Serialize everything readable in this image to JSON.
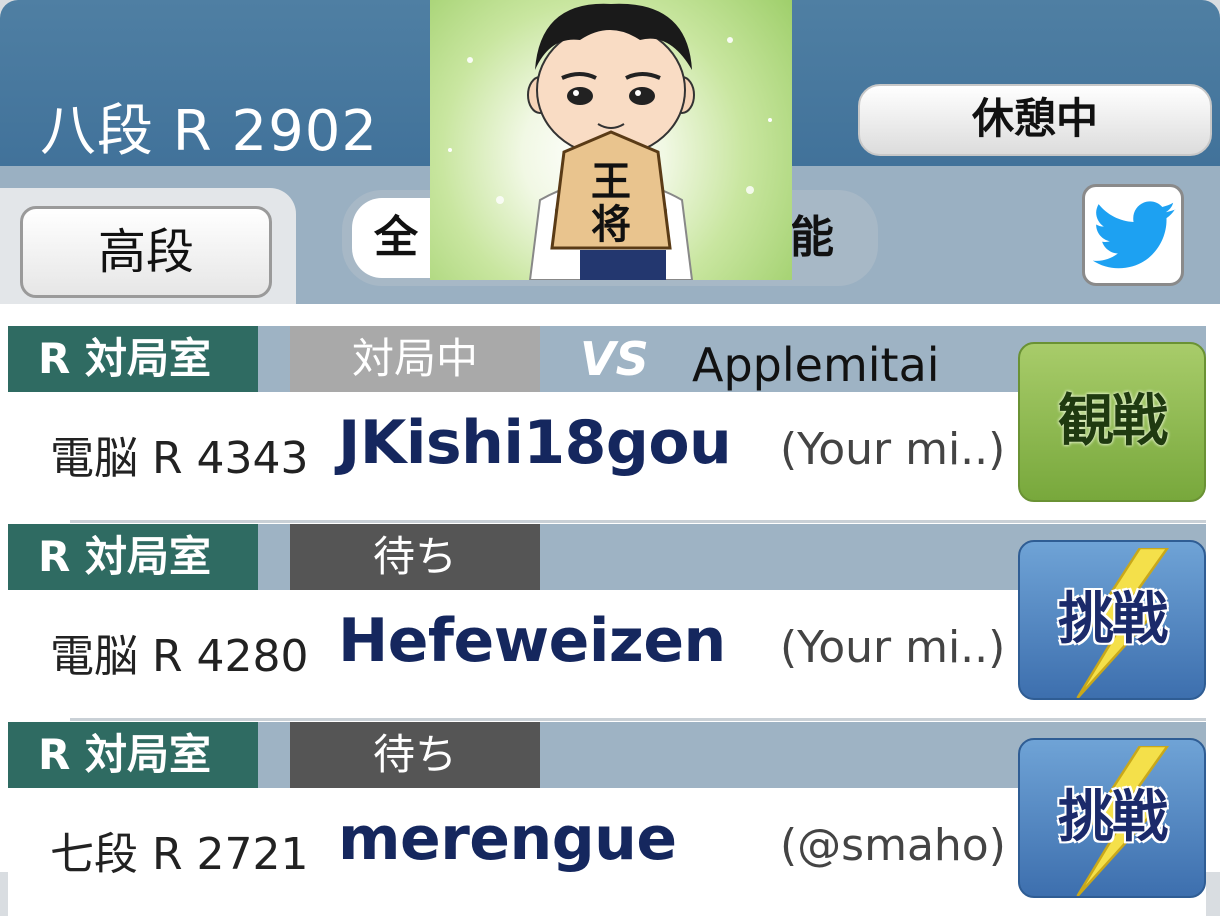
{
  "header": {
    "rank_rating": "八段  R 2902",
    "status_button": "休憩中"
  },
  "filters": {
    "tab_high": "高段",
    "segment_all": "全",
    "segment_available": "能"
  },
  "icons": {
    "twitter": "twitter-bird-icon",
    "avatar": "shogi-king-avatar"
  },
  "colors": {
    "header_bg": "#4a7ba0",
    "room_label": "#2f6b62",
    "username": "#15275e",
    "watch_button": "#8bb84e",
    "challenge_button": "#4f84c0",
    "twitter_blue": "#1da1f2"
  },
  "rooms": [
    {
      "room": "R 対局室",
      "state": "対局中",
      "vs": "VS",
      "opponent": "Applemitai",
      "rank": "電脳 R 4343",
      "username": "JKishi18gou",
      "comment": "(Your mi..)",
      "action": "観戦"
    },
    {
      "room": "R 対局室",
      "state": "待ち",
      "rank": "電脳 R 4280",
      "username": "Hefeweizen",
      "comment": "(Your mi..)",
      "action": "挑戦"
    },
    {
      "room": "R 対局室",
      "state": "待ち",
      "rank": "七段 R 2721",
      "username": "merengue",
      "comment": "(@smaho)",
      "action": "挑戦"
    }
  ]
}
